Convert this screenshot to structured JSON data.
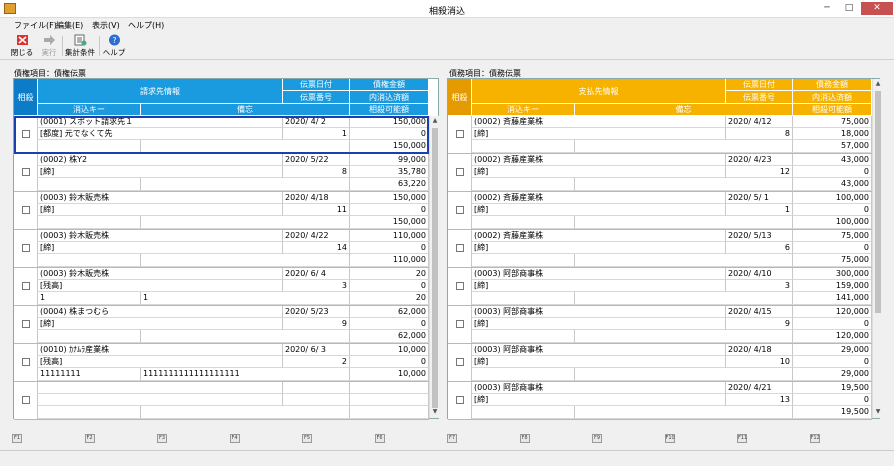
{
  "window": {
    "title": "相殺消込",
    "minimize": "─",
    "maximize": "□",
    "close": "✕"
  },
  "menu": [
    {
      "label": "ファイル(F)"
    },
    {
      "label": "編集(E)"
    },
    {
      "label": "表示(V)"
    },
    {
      "label": "ヘルプ(H)"
    }
  ],
  "toolbar": {
    "close": "閉じる",
    "run": "実行",
    "aggregate": "集計条件",
    "help": "ヘルプ"
  },
  "left": {
    "section_label": "債権項目：債権伝票",
    "headers": {
      "sousai": "相殺",
      "info": "請求先情報",
      "date": "伝票日付",
      "amount": "債権金額",
      "number": "伝票番号",
      "applied": "内消込済額",
      "key": "消込キー",
      "memo": "備忘",
      "available": "相殺可能額"
    },
    "rows": [
      {
        "partner": "(0001) スポット請求先１",
        "sub": "[都度] 元でなくて先",
        "date": "2020/ 4/ 2",
        "num": "1",
        "amount": "150,000",
        "applied": "0",
        "available": "150,000",
        "key": "",
        "memo": ""
      },
      {
        "partner": "(0002) 株Y2",
        "sub": "[締]",
        "date": "2020/ 5/22",
        "num": "8",
        "amount": "99,000",
        "applied": "35,780",
        "available": "63,220",
        "key": "",
        "memo": ""
      },
      {
        "partner": "(0003) 鈴木販売株",
        "sub": "[締]",
        "date": "2020/ 4/18",
        "num": "11",
        "amount": "150,000",
        "applied": "0",
        "available": "150,000",
        "key": "",
        "memo": ""
      },
      {
        "partner": "(0003) 鈴木販売株",
        "sub": "[締]",
        "date": "2020/ 4/22",
        "num": "14",
        "amount": "110,000",
        "applied": "0",
        "available": "110,000",
        "key": "",
        "memo": ""
      },
      {
        "partner": "(0003) 鈴木販売株",
        "sub": "[残高]",
        "date": "2020/ 6/ 4",
        "num": "3",
        "amount": "20",
        "applied": "0",
        "available": "20",
        "key": "1",
        "memo": "1"
      },
      {
        "partner": "(0004) 株まつむら",
        "sub": "[締]",
        "date": "2020/ 5/23",
        "num": "9",
        "amount": "62,000",
        "applied": "0",
        "available": "62,000",
        "key": "",
        "memo": ""
      },
      {
        "partner": "(0010) ｶﾅﾑﾗ産業株",
        "sub": "[残高]",
        "date": "2020/ 6/ 3",
        "num": "2",
        "amount": "10,000",
        "applied": "0",
        "available": "10,000",
        "key": "11111111",
        "memo": "1111111111111111111"
      },
      {
        "partner": "",
        "sub": "",
        "date": "",
        "num": "",
        "amount": "",
        "applied": "",
        "available": "",
        "key": "",
        "memo": ""
      }
    ]
  },
  "right": {
    "section_label": "債務項目：債務伝票",
    "headers": {
      "sousai": "相殺",
      "info": "支払先情報",
      "date": "伝票日付",
      "amount": "債務金額",
      "number": "伝票番号",
      "applied": "内消込済額",
      "key": "消込キー",
      "memo": "備忘",
      "available": "相殺可能額"
    },
    "rows": [
      {
        "partner": "(0002) 斉藤産業株",
        "sub": "[締]",
        "date": "2020/ 4/12",
        "num": "8",
        "amount": "75,000",
        "applied": "18,000",
        "available": "57,000",
        "key": "",
        "memo": ""
      },
      {
        "partner": "(0002) 斉藤産業株",
        "sub": "[締]",
        "date": "2020/ 4/23",
        "num": "12",
        "amount": "43,000",
        "applied": "0",
        "available": "43,000",
        "key": "",
        "memo": ""
      },
      {
        "partner": "(0002) 斉藤産業株",
        "sub": "[締]",
        "date": "2020/ 5/ 1",
        "num": "1",
        "amount": "100,000",
        "applied": "0",
        "available": "100,000",
        "key": "",
        "memo": ""
      },
      {
        "partner": "(0002) 斉藤産業株",
        "sub": "[締]",
        "date": "2020/ 5/13",
        "num": "6",
        "amount": "75,000",
        "applied": "0",
        "available": "75,000",
        "key": "",
        "memo": ""
      },
      {
        "partner": "(0003) 阿部商事株",
        "sub": "[締]",
        "date": "2020/ 4/10",
        "num": "3",
        "amount": "300,000",
        "applied": "159,000",
        "available": "141,000",
        "key": "",
        "memo": ""
      },
      {
        "partner": "(0003) 阿部商事株",
        "sub": "[締]",
        "date": "2020/ 4/15",
        "num": "9",
        "amount": "120,000",
        "applied": "0",
        "available": "120,000",
        "key": "",
        "memo": ""
      },
      {
        "partner": "(0003) 阿部商事株",
        "sub": "[締]",
        "date": "2020/ 4/18",
        "num": "10",
        "amount": "29,000",
        "applied": "0",
        "available": "29,000",
        "key": "",
        "memo": ""
      },
      {
        "partner": "(0003) 阿部商事株",
        "sub": "[締]",
        "date": "2020/ 4/21",
        "num": "13",
        "amount": "19,500",
        "applied": "0",
        "available": "19,500",
        "key": "",
        "memo": ""
      }
    ]
  },
  "fkeys": [
    "F1",
    "F2",
    "F3",
    "F4",
    "F5",
    "F6",
    "F7",
    "F8",
    "F9",
    "F10",
    "F11",
    "F12"
  ],
  "colors": {
    "left_header": "#1a9be0",
    "right_header": "#f7b200",
    "selection": "#1a3fb0"
  }
}
